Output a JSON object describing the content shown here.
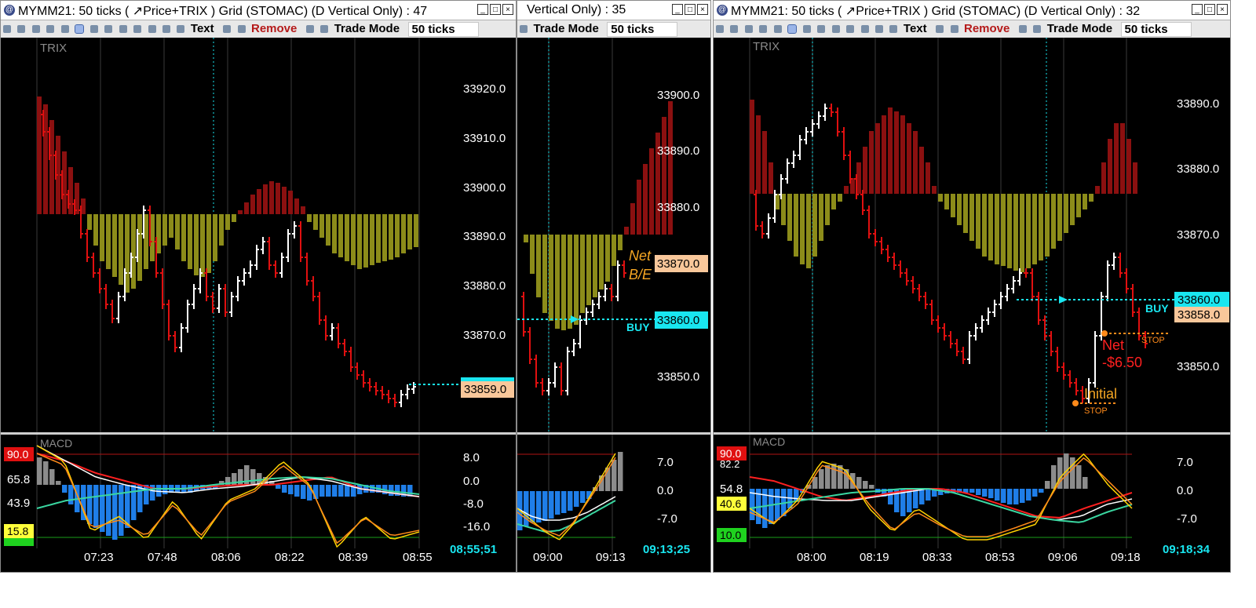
{
  "windows": [
    {
      "title": "MYMM21: 50 ticks ( ↗Price+TRIX ) Grid (STOMAC) (D  Vertical Only) : 47",
      "toolbar": {
        "text_label": "Text",
        "remove_label": "Remove",
        "trade_mode_label": "Trade Mode",
        "ticks_value": "50 ticks"
      },
      "indicator_label": "TRIX",
      "macd_label": "MACD",
      "price_axis": [
        "33920.0",
        "33910.0",
        "33900.0",
        "33890.0",
        "33880.0",
        "33870.0"
      ],
      "price_tag": "33859.0",
      "macd_axis": [
        "8.0",
        "0.0",
        "-8.0",
        "-16.0"
      ],
      "stoch_levels": [
        "90.0",
        "65.8",
        "43.9",
        "15.8"
      ],
      "time_axis": [
        "07:23",
        "07:48",
        "08:06",
        "08:22",
        "08:39",
        "08:55"
      ],
      "clock": "08;55;51"
    },
    {
      "title": "Vertical Only) : 35",
      "toolbar": {
        "trade_mode_label": "Trade Mode",
        "ticks_value": "50 ticks"
      },
      "price_axis": [
        "33900.0",
        "33890.0",
        "33880.0",
        "33870.0",
        "33860.0",
        "33850.0"
      ],
      "annotation_net": "Net",
      "annotation_be": "B/E",
      "buy_label": "BUY",
      "macd_axis": [
        "7.0",
        "0.0",
        "-7.0"
      ],
      "time_axis": [
        "09:00",
        "09:13"
      ],
      "clock": "09;13;25"
    },
    {
      "title": "MYMM21: 50 ticks ( ↗Price+TRIX ) Grid (STOMAC) (D  Vertical Only) : 32",
      "toolbar": {
        "text_label": "Text",
        "remove_label": "Remove",
        "trade_mode_label": "Trade Mode",
        "ticks_value": "50 ticks"
      },
      "indicator_label": "TRIX",
      "macd_label": "MACD",
      "price_axis": [
        "33890.0",
        "33880.0",
        "33870.0",
        "33860.0",
        "33858.0",
        "33850.0"
      ],
      "buy_label": "BUY",
      "stop_label": "STOP",
      "net_label": "Net",
      "net_value": "-$6.50",
      "initial_label": "Initial",
      "initial_stop_label": "STOP",
      "macd_axis": [
        "7.0",
        "0.0",
        "-7.0"
      ],
      "stoch_levels": [
        "90.0",
        "82.2",
        "54.8",
        "40.6",
        "10.0"
      ],
      "time_axis": [
        "08:00",
        "08:19",
        "08:33",
        "08:53",
        "09:06",
        "09:18"
      ],
      "clock": "09;18;34"
    }
  ],
  "colors": {
    "background": "#000000",
    "trix_up": "#8b1010",
    "trix_down": "#8c8c1a",
    "bar_up": "#ffffff",
    "bar_down": "#e01010",
    "cyan": "#19e6f0",
    "tag_orange": "#f9c79a",
    "macd_hist_neg": "#1f7ee8",
    "macd_hist_pos": "#8c8c8c",
    "yellow_line": "#ffd200",
    "orange_line": "#ff8a1a",
    "green_line": "#3ad6a0",
    "red_line": "#ff2020",
    "annotation_orange": "#f5a623"
  }
}
